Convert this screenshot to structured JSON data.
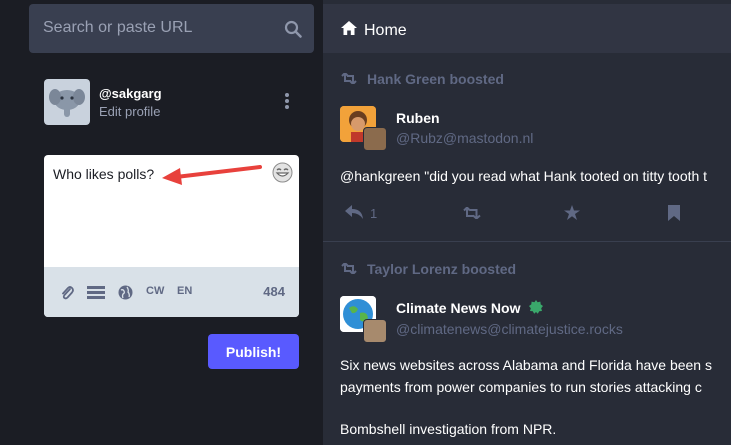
{
  "search": {
    "placeholder": "Search or paste URL",
    "icon": "search-icon"
  },
  "profile": {
    "handle": "@sakgarg",
    "edit_label": "Edit profile"
  },
  "compose": {
    "text": "Who likes polls?",
    "tools": {
      "cw": "CW",
      "lang": "EN"
    },
    "char_count": "484",
    "publish_label": "Publish!"
  },
  "column": {
    "title": "Home"
  },
  "statuses": [
    {
      "boosted_by": "Hank Green boosted",
      "name": "Ruben",
      "acct": "@Rubz@mastodon.nl",
      "content": "@hankgreen \"did you read what Hank tooted on titty tooth t",
      "reply_count": "1"
    },
    {
      "boosted_by": "Taylor Lorenz boosted",
      "name": "Climate News Now",
      "acct": "@climatenews@climatejustice.rocks",
      "content_lines": [
        "Six news websites across Alabama and Florida have been s",
        "payments from power companies to run stories attacking c",
        "Bombshell investigation from NPR."
      ]
    }
  ],
  "colors": {
    "accent": "#595aff",
    "annotation_arrow": "#e8413c"
  }
}
